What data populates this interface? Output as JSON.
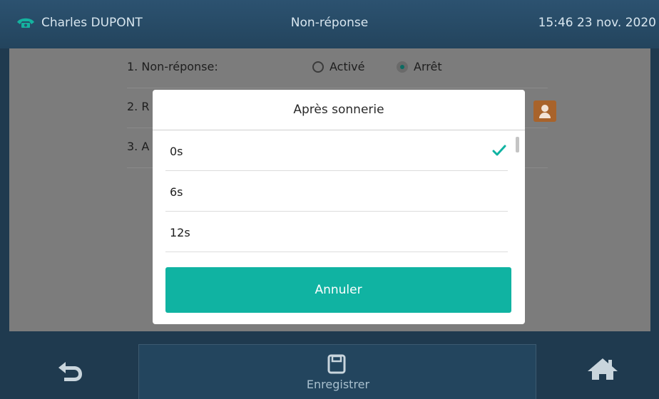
{
  "header": {
    "user_name": "Charles DUPONT",
    "title": "Non-réponse",
    "datetime": "15:46  23 nov. 2020"
  },
  "settings": {
    "rows": [
      {
        "label": "1. Non-réponse:"
      },
      {
        "label": "2. R"
      },
      {
        "label": "3. A"
      }
    ],
    "radio_on_label": "Activé",
    "radio_off_label": "Arrêt",
    "selected": "Arrêt"
  },
  "dialog": {
    "title": "Après sonnerie",
    "options": [
      {
        "label": "0s",
        "selected": true
      },
      {
        "label": "6s",
        "selected": false
      },
      {
        "label": "12s",
        "selected": false
      }
    ],
    "cancel_label": "Annuler"
  },
  "softkeys": {
    "back_icon": "back-icon",
    "save_label": "Enregistrer",
    "save_icon": "floppy-disk-icon",
    "home_icon": "home-icon"
  },
  "colors": {
    "accent": "#10b3a2",
    "topbar": "#2c5270",
    "contact": "#a8632b"
  }
}
